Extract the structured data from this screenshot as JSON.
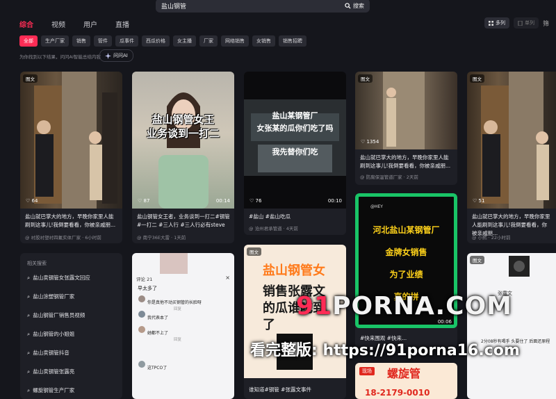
{
  "search": {
    "query": "盐山钢管",
    "button_label": "搜索"
  },
  "tabs": [
    "综合",
    "视频",
    "用户",
    "直播"
  ],
  "view_toggle": {
    "multi": "多列",
    "single": "单列",
    "edge": "筛"
  },
  "chips": [
    "全部",
    "生产厂家",
    "销售",
    "管件",
    "瓜事件",
    "西瓜价格",
    "女主播",
    "厂家",
    "网络销售",
    "女销售",
    "销售招聘"
  ],
  "hint": "为你找到以下结果，问问AI智能总结内容",
  "ai_button": "问问AI",
  "cards": [
    {
      "badge": "图文",
      "likes": "64",
      "caption": "盐山就巴掌大的地方，早晚你家里人能刷到这事儿!我倒要看看，你被亲戚朋...",
      "author": "@ 衬胶衬塑衬四氟实体厂家",
      "time": "· 6小时前"
    },
    {
      "overlay1": "盐山钢管女王",
      "overlay2": "业务谈到一打二",
      "likes": "87",
      "duration": "00:14",
      "caption": "盐山钢管女王者，业务谈到一打二#钢管 #一打二 #三人行 #三人行必有steve",
      "author": "@ 南宁36E大雷",
      "time": "· 1天前"
    },
    {
      "overlay1": "盐山某钢管厂",
      "overlay2": "女张某的瓜你们吃了吗",
      "overlay3": "我先替你们吃",
      "likes": "76",
      "duration": "00:10",
      "caption": "#盐山 #盐山吃瓜",
      "author": "@ 沧州君承管道",
      "time": "· 4天前"
    },
    {
      "badge": "图文",
      "likes": "1354",
      "caption": "盐山就巴掌大的地方，早晚你家里人能刷到这事儿!我倒要看看，你被亲戚朋...",
      "author": "@ 防腐保温管道厂家",
      "time": "· 2天前"
    },
    {
      "badge": "图文",
      "likes": "51",
      "caption": "盐山就巴掌大的地方，早晚你家里人能刷到这事儿!我倒要看看，你被亲戚朋...",
      "author": "@ 小熙",
      "time": "· 22小时前"
    },
    {
      "comments_title": "评论 21",
      "comments": [
        "早太多了",
        "你是真他不动买钢管的长脸呀",
        "我代表本了",
        "她都不上了",
        "这TPCO了"
      ],
      "reply_label": "回复"
    },
    {
      "badge": "图文",
      "overlay1": "盐山钢管女",
      "overlay2": "销售张露文",
      "overlay3": "的瓜谁吃到",
      "overlay4": "了",
      "caption": "谁知道#钢管 #张露文事件"
    },
    {
      "handle": "@HEY",
      "overlay1": "河北盐山某钢管厂",
      "overlay2": "金牌女销售",
      "overlay3": "为了业绩",
      "overlay4": "真的拼",
      "duration": "00:06",
      "caption": "#快来围观 #快来..."
    },
    {
      "badge": "现场",
      "overlay1": "螺旋管",
      "overlay2": "18-2179-0010"
    },
    {
      "badge": "图文",
      "comment1": "2分08秒有喝手 头要住了 后面还原程",
      "name": "张露文"
    }
  ],
  "related": {
    "title": "相关搜索",
    "items": [
      "盐山卖钢管女张露文回应",
      "盐山涂塑钢管厂家",
      "盐山钢管厂销售员视频",
      "盐山钢管的小姐姐",
      "盐山卖钢管抖音",
      "盐山卖钢管张露亮",
      "螺旋钢管生产厂家"
    ]
  },
  "watermark": {
    "line1_a": "91",
    "line1_b": "PORNA.COM",
    "line2": "看完整版: https://91porna16.com"
  }
}
